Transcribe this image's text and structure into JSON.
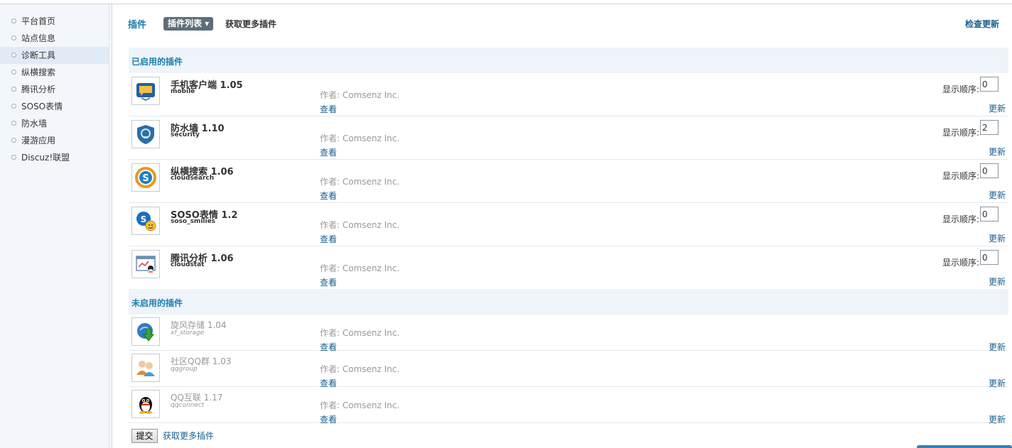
{
  "sidebar": {
    "items": [
      {
        "label": "平台首页",
        "active": false
      },
      {
        "label": "站点信息",
        "active": false
      },
      {
        "label": "诊断工具",
        "active": true
      },
      {
        "label": "纵横搜索",
        "active": false
      },
      {
        "label": "腾讯分析",
        "active": false
      },
      {
        "label": "SOSO表情",
        "active": false
      },
      {
        "label": "防水墙",
        "active": false
      },
      {
        "label": "漫游应用",
        "active": false
      },
      {
        "label": "Discuz!联盟",
        "active": false
      }
    ]
  },
  "header": {
    "title": "插件",
    "tab_active": "插件列表 ▾",
    "tab_more": "获取更多插件",
    "check_update": "检查更新"
  },
  "enabled_section": {
    "title": "已启用的插件",
    "order_label": "显示顺序:",
    "plugins": [
      {
        "name": "手机客户端 1.05",
        "id": "mobile",
        "author": "作者: Comsenz Inc.",
        "view": "查看",
        "order": "0",
        "update": "更新",
        "icon": "mobile-client-icon"
      },
      {
        "name": "防水墙 1.10",
        "id": "security",
        "author": "作者: Comsenz Inc.",
        "view": "查看",
        "order": "2",
        "update": "更新",
        "icon": "security-shield-icon"
      },
      {
        "name": "纵横搜索 1.06",
        "id": "cloudsearch",
        "author": "作者: Comsenz Inc.",
        "view": "查看",
        "order": "0",
        "update": "更新",
        "icon": "cloudsearch-icon"
      },
      {
        "name": "SOSO表情 1.2",
        "id": "soso_smilies",
        "author": "作者: Comsenz Inc.",
        "view": "查看",
        "order": "0",
        "update": "更新",
        "icon": "soso-smilies-icon"
      },
      {
        "name": "腾讯分析 1.06",
        "id": "cloudstat",
        "author": "作者: Comsenz Inc.",
        "view": "查看",
        "order": "0",
        "update": "更新",
        "icon": "cloudstat-icon"
      }
    ]
  },
  "disabled_section": {
    "title": "未启用的插件",
    "plugins": [
      {
        "name": "旋风存储 1.04",
        "id": "xf_storage",
        "author": "作者: Comsenz Inc.",
        "view": "查看",
        "update": "更新",
        "icon": "storage-download-icon"
      },
      {
        "name": "社区QQ群 1.03",
        "id": "qqgroup",
        "author": "作者: Comsenz Inc.",
        "view": "查看",
        "update": "更新",
        "icon": "qq-group-icon"
      },
      {
        "name": "QQ互联 1.17",
        "id": "qqconnect",
        "author": "作者: Comsenz Inc.",
        "view": "查看",
        "update": "更新",
        "icon": "qq-penguin-icon"
      }
    ]
  },
  "footer": {
    "submit_label": "提交",
    "more_link": "获取更多插件"
  },
  "colors": {
    "accent": "#1a7fb0",
    "link": "#1a5f8f",
    "section_bg": "#eef4fa",
    "sidebar_bg": "#f3f7fb"
  }
}
